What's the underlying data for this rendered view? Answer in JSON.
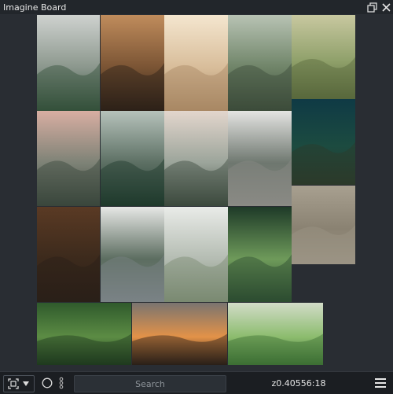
{
  "window": {
    "title": "Imagine Board"
  },
  "titlebar": {
    "restore_icon": "restore-window-icon",
    "close_icon": "close-icon"
  },
  "images": [
    {
      "name": "image-misty-forest-valley",
      "colors": [
        "#cfd2cf",
        "#8b978d",
        "#34503a"
      ]
    },
    {
      "name": "image-tree-bark-closeup",
      "colors": [
        "#c08c5c",
        "#7a5434",
        "#2d2118"
      ]
    },
    {
      "name": "image-sunlit-dried-flower",
      "colors": [
        "#f4e6cf",
        "#d8bd9a",
        "#a88864"
      ]
    },
    {
      "name": "image-river-bank-teapot",
      "colors": [
        "#b8c3b4",
        "#6f8468",
        "#3c4b3a"
      ]
    },
    {
      "name": "image-butterfly-wildflowers",
      "colors": [
        "#c8c8a0",
        "#8fa06a",
        "#58683c"
      ]
    },
    {
      "name": "image-pink-mist-mountains",
      "colors": [
        "#d8aea2",
        "#7d8276",
        "#3a463c"
      ]
    },
    {
      "name": "image-foggy-pine-forest",
      "colors": [
        "#b6c2bb",
        "#5c6f63",
        "#1f3a2c"
      ]
    },
    {
      "name": "image-snowy-peaks-forest",
      "colors": [
        "#e3d6cd",
        "#9ba49a",
        "#3c4a3d"
      ]
    },
    {
      "name": "image-forest-road",
      "colors": [
        "#e4e4e2",
        "#6e776f",
        "#8a8a84"
      ]
    },
    {
      "name": "image-aerial-coastline",
      "colors": [
        "#0f3a45",
        "#1c4b40",
        "#2c3a2a"
      ]
    },
    {
      "name": "image-fallen-leaves",
      "colors": [
        "#5a3a24",
        "#3c2a1c",
        "#2a2018"
      ]
    },
    {
      "name": "image-misty-lake",
      "colors": [
        "#e6e7e5",
        "#5c6d60",
        "#7a8286"
      ]
    },
    {
      "name": "image-foggy-hills-cabin",
      "colors": [
        "#e9ebe8",
        "#b4bcb2",
        "#7a8a72"
      ]
    },
    {
      "name": "image-fern-leaf",
      "colors": [
        "#1e3a28",
        "#6e9a5a",
        "#2c4c30"
      ]
    },
    {
      "name": "image-sand-texture",
      "colors": [
        "#a8a090",
        "#8a8272",
        "#9c9484"
      ]
    },
    {
      "name": "image-green-leaves",
      "colors": [
        "#2f5a2c",
        "#5c8c44",
        "#1f3a1e"
      ]
    },
    {
      "name": "image-sunset-silhouettes",
      "colors": [
        "#7a7470",
        "#e39248",
        "#2a2018"
      ]
    },
    {
      "name": "image-leaf-sprouts",
      "colors": [
        "#d2dcc8",
        "#8cbc6e",
        "#3c6e34"
      ]
    }
  ],
  "statusbar": {
    "fit_icon": "fit-to-screen-icon",
    "dropdown_icon": "dropdown-arrow-icon",
    "circle_icon": "circle-icon",
    "more_icon": "vertical-dots-icon",
    "search_placeholder": "Search",
    "zoom_text": "z0.40556:18",
    "menu_icon": "hamburger-menu-icon"
  }
}
